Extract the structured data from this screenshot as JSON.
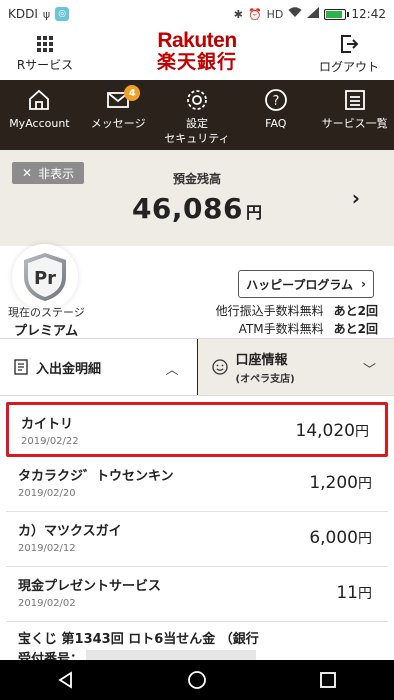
{
  "status_bar": {
    "carrier": "KDDI",
    "time": "12:42",
    "battery_level": 0.9
  },
  "header": {
    "services_label": "Rサービス",
    "logo_en": "Rakuten",
    "logo_jp": "楽天銀行",
    "logout_label": "ログアウト"
  },
  "nav": [
    {
      "label": "MyAccount",
      "icon": "home-icon"
    },
    {
      "label": "メッセージ",
      "icon": "mail-icon",
      "badge": "4"
    },
    {
      "label": "設定\nセキュリティ",
      "icon": "gear-icon"
    },
    {
      "label": "FAQ",
      "icon": "question-icon"
    },
    {
      "label": "サービス一覧",
      "icon": "list-icon"
    }
  ],
  "balance": {
    "hide_label": "非表示",
    "label": "預金残高",
    "amount": "46,086",
    "currency": "円"
  },
  "stage": {
    "badge_text": "Pr",
    "label": "現在のステージ",
    "value": "プレミアム",
    "happy_program_label": "ハッピープログラム",
    "fees": [
      {
        "label": "他行振込手数料無料",
        "value": "あと2回"
      },
      {
        "label": "ATM手数料無料",
        "value": "あと2回"
      }
    ]
  },
  "tabs": {
    "statement_label": "入出金明細",
    "account_label": "口座情報",
    "account_sub": "(オペラ支店)"
  },
  "transactions": [
    {
      "name": "カイトリ",
      "date": "2019/02/22",
      "amount": "14,020",
      "currency": "円"
    },
    {
      "name": "タカラクジ゛トウセンキン",
      "date": "2019/02/20",
      "amount": "1,200",
      "currency": "円"
    },
    {
      "name": "カ）マツクスガイ",
      "date": "2019/02/12",
      "amount": "6,000",
      "currency": "円"
    },
    {
      "name": "現金プレゼントサービス",
      "date": "2019/02/02",
      "amount": "11",
      "currency": "円"
    },
    {
      "name": "宝くじ 第1343回 ロト6当せん金 （銀行",
      "name_line2": "受付番号："
    }
  ],
  "colors": {
    "brand_red": "#bf0000",
    "nav_dark": "#2b221c",
    "badge_orange": "#f0a026",
    "highlight_red": "#d8191f",
    "balance_bg": "#efece6"
  }
}
